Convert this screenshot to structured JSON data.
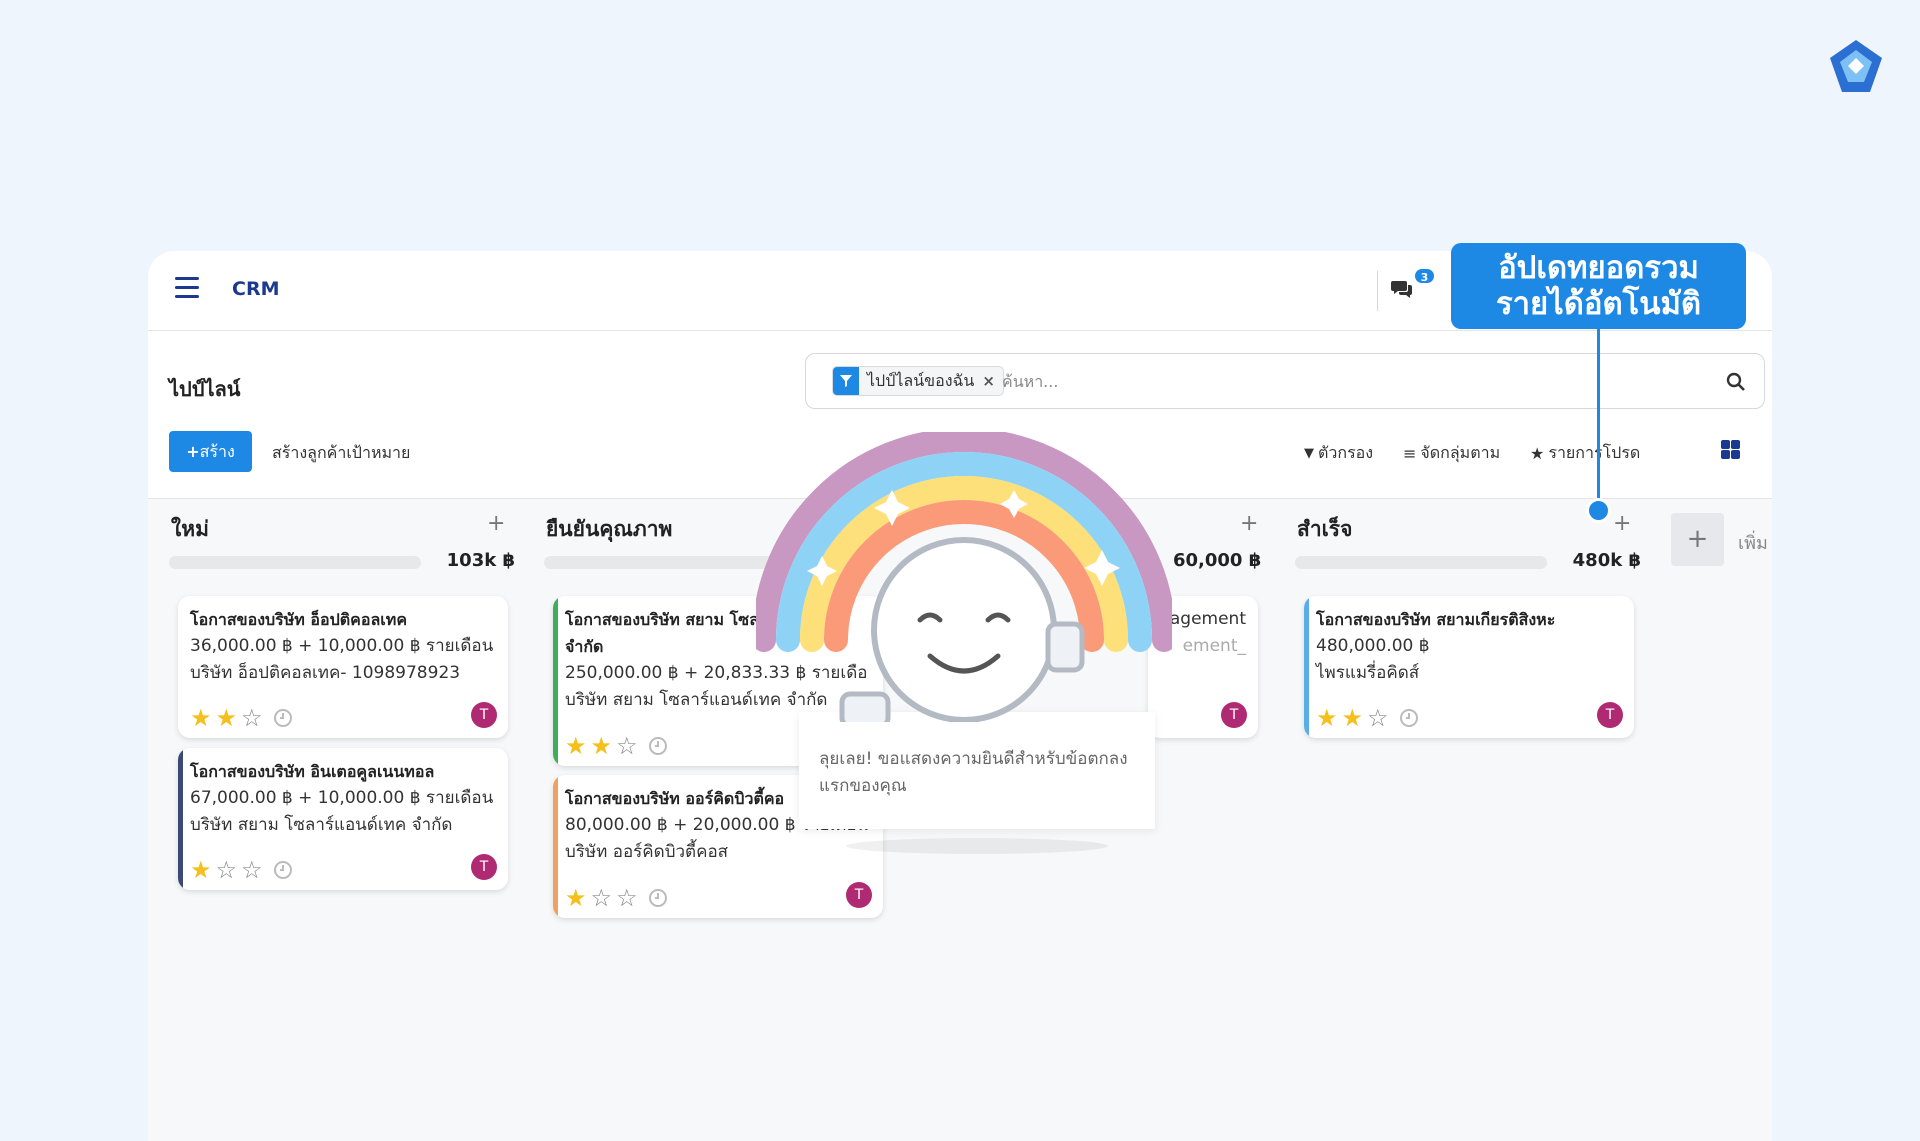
{
  "app": {
    "name": "CRM",
    "chat_badge": "3"
  },
  "page": {
    "title": "ไปป์ไลน์"
  },
  "search": {
    "facet_label": "ไปป์ไลน์ของฉัน",
    "placeholder": "ค้นหา..."
  },
  "toolbar": {
    "create_label": "สร้าง",
    "generate_label": "สร้างลูกค้าเป้าหมาย",
    "filter_label": "ตัวกรอง",
    "groupby_label": "จัดกลุ่มตาม",
    "favorites_label": "รายการโปรด"
  },
  "columns": [
    {
      "title": "ใหม่",
      "total": "103k ฿"
    },
    {
      "title": "ยืนยันคุณภาพ",
      "total": ""
    },
    {
      "title": "",
      "total": "60,000 ฿"
    },
    {
      "title": "สำเร็จ",
      "total": "480k ฿"
    }
  ],
  "add_column_label": "เพิ่ม",
  "cards": [
    {
      "title": "โอกาสของบริษัท อ็อปติคอลเทค",
      "amount": "36,000.00 ฿ + 10,000.00 ฿ รายเดือน",
      "company": "บริษัท อ็อปติคอลเทค- 1098978923",
      "stars": 2,
      "avatar": "T",
      "accent": ""
    },
    {
      "title": "โอกาสของบริษัท อินเตอคูลเนนทอล",
      "amount": "67,000.00 ฿ + 10,000.00 ฿ รายเดือน",
      "company": "บริษัท สยาม โซลาร์แอนด์เทค จำกัด",
      "stars": 1,
      "avatar": "T",
      "accent": "#3a4a75"
    },
    {
      "title": "โอกาสของบริษัท สยาม โซล",
      "title2": "จำกัด",
      "amount": "250,000.00 ฿ + 20,833.33 ฿ รายเดือ",
      "company": "บริษัท สยาม โซลาร์แอนด์เทค จำกัด",
      "stars": 2,
      "avatar": "T",
      "accent": "#3fae5a"
    },
    {
      "title": "โอกาสของบริษัท ออร์คิดบิวตี้คอ",
      "amount": "80,000.00 ฿ + 20,000.00 ฿ รายเดือน",
      "company": "บริษัท ออร์คิดบิวตี้คอส",
      "stars": 1,
      "avatar": "T",
      "accent": "#f0a060"
    },
    {
      "title": "agement",
      "amount": "",
      "company": "ement_",
      "stars": 0,
      "avatar": "T",
      "accent": ""
    },
    {
      "title": "โอกาสของบริษัท สยามเกียรติสิงหะ",
      "amount": "480,000.00 ฿",
      "company": "ไพรแมรี่อคิดส์",
      "stars": 2,
      "avatar": "T",
      "accent": "#5aaee8"
    }
  ],
  "popup": {
    "message": "ลุยเลย! ขอแสดงความยินดีสำหรับข้อตกลงแรกของคุณ"
  },
  "callout": {
    "line1": "อัปเดทยอดรวม",
    "line2": "รายได้อัตโนมัติ"
  },
  "colors": {
    "accent": "#1e88e5",
    "brand": "#1b3a8f",
    "avatar": "#b02a73",
    "star": "#f5bf1c"
  }
}
